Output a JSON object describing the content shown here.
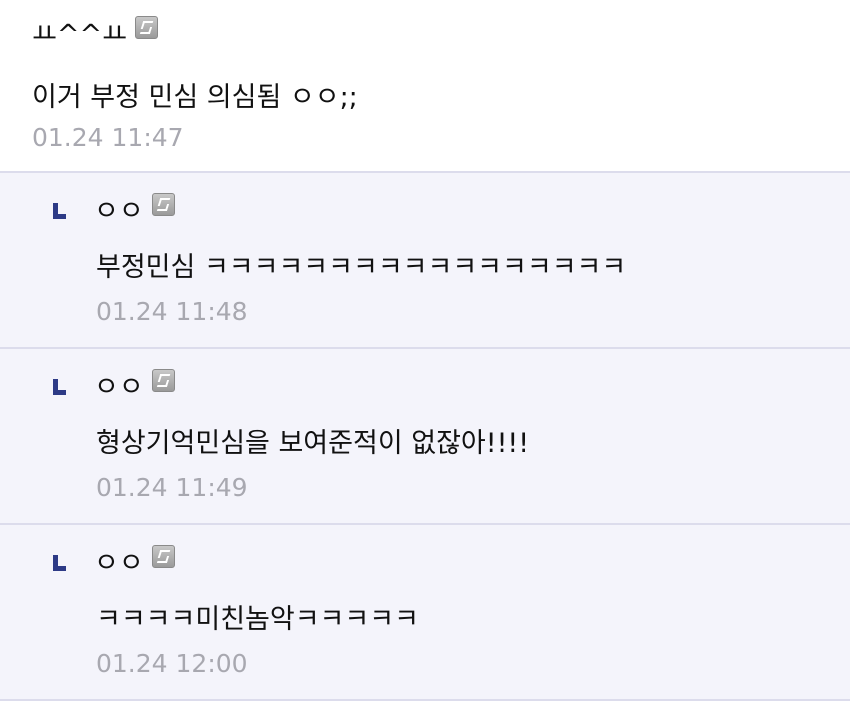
{
  "comments": [
    {
      "nickname": "ㅛ^^ㅛ",
      "text": "이거 부정 민심 의심됨 ㅇㅇ;;",
      "date": "01.24 11:47"
    }
  ],
  "replies": [
    {
      "nickname": "ㅇㅇ",
      "text": "부정민심 ㅋㅋㅋㅋㅋㅋㅋㅋㅋㅋㅋㅋㅋㅋㅋㅋㅋ",
      "date": "01.24 11:48"
    },
    {
      "nickname": "ㅇㅇ",
      "text": "형상기억민심을 보여준적이 없잖아!!!!",
      "date": "01.24 11:49"
    },
    {
      "nickname": "ㅇㅇ",
      "text": "ㅋㅋㅋㅋ미친놈악ㅋㅋㅋㅋㅋ",
      "date": "01.24 12:00"
    }
  ],
  "icons": {
    "reply": "reply-arrow-icon",
    "badge": "fixed-nickname-icon"
  },
  "colors": {
    "reply_background": "#f4f4fb",
    "divider": "#dcdcec",
    "reply_arrow": "#2d3a86",
    "date_text": "#a8a8b0"
  }
}
